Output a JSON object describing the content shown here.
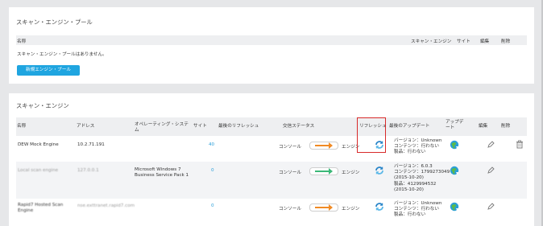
{
  "pool_panel": {
    "title": "スキャン・エンジン・プール",
    "headers": {
      "name": "名称",
      "engines": "スキャン・エンジン",
      "sites": "サイト",
      "edit": "編集",
      "delete": "削除"
    },
    "empty_text": "スキャン・エンジン・プールはありません。",
    "new_button": "新規エンジン・プール"
  },
  "engine_panel": {
    "title": "スキャン・エンジン",
    "headers": {
      "name": "名称",
      "address": "アドレス",
      "os": "オペレーティング・システム",
      "sites": "サイト",
      "last_refresh": "最後のリフレッシュ",
      "comm_status": "交信ステータス",
      "refresh": "リフレッシュ",
      "last_update": "最後のアップデート",
      "updater": "アップデート",
      "edit": "編集",
      "delete": "削除"
    },
    "rows": [
      {
        "name": "DEW Mock Engine",
        "address": "10.2.71.191",
        "os": "",
        "sites": "40",
        "comm_console": "コンソール",
        "comm_engine": "エンジン",
        "arrow_color": "#f08a24",
        "update_lines": [
          "バージョン：Unknown",
          "コンテンツ：行わない",
          "製品：行わない"
        ]
      },
      {
        "name": "Local scan engine",
        "address": "127.0.0.1",
        "os": "Microsoft Windows 7 Business Service Pack 1",
        "sites": "0",
        "comm_console": "コンソール",
        "comm_engine": "エンジン",
        "arrow_color": "#3cb878",
        "update_lines": [
          "バージョン：6.0.3",
          "コンテンツ：1799273049",
          "(2015-10-20)",
          "製品：4129994532",
          "(2015-10-20)"
        ]
      },
      {
        "name": "Rapid7 Hosted Scan Engine",
        "address": "nse.exttranet.rapid7.com",
        "os": "",
        "sites": "0",
        "comm_console": "コンソール",
        "comm_engine": "エンジン",
        "arrow_color": "#f08a24",
        "update_lines": [
          "バージョン：Unknown",
          "コンテンツ：行わない",
          "製品：行わない"
        ]
      }
    ]
  }
}
